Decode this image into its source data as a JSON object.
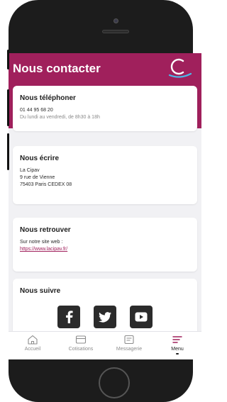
{
  "header": {
    "title": "Nous contacter"
  },
  "cards": {
    "phone": {
      "title": "Nous téléphoner",
      "number": "01 44 95 68 20",
      "hours": "Du lundi au vendredi, de 8h30 à 18h"
    },
    "mail": {
      "title": "Nous écrire",
      "line1": "La Cipav",
      "line2": "9 rue de Vienne",
      "line3": "75403 Paris CEDEX 08"
    },
    "web": {
      "title": "Nous retrouver",
      "intro": "Sur notre site web :",
      "url": "https://www.lacipav.fr/"
    },
    "social": {
      "title": "Nous suivre",
      "icons": [
        "facebook-icon",
        "twitter-icon",
        "youtube-icon"
      ]
    }
  },
  "tabbar": {
    "items": [
      {
        "label": "Accueil",
        "icon": "home-icon"
      },
      {
        "label": "Cotisations",
        "icon": "card-icon"
      },
      {
        "label": "Messagerie",
        "icon": "message-icon"
      },
      {
        "label": "Menu",
        "icon": "menu-icon",
        "active": true
      }
    ]
  },
  "colors": {
    "brand": "#a0205c",
    "logo_accent": "#4bb8e8",
    "background": "#f1f1f4"
  }
}
